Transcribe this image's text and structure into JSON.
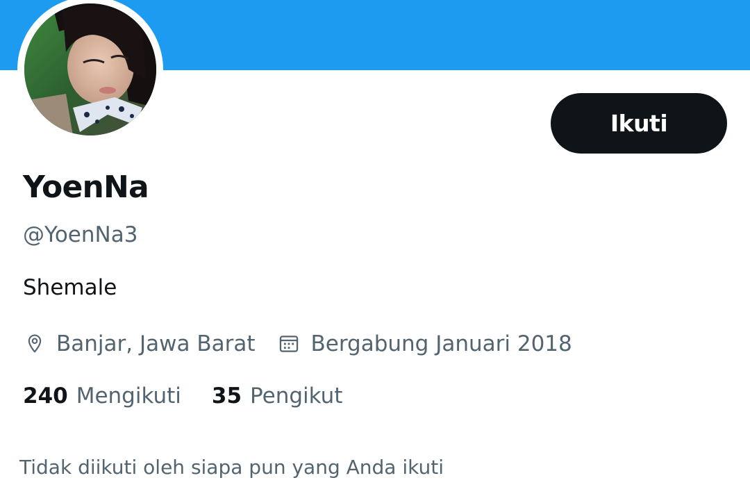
{
  "profile": {
    "display_name": "YoenNa",
    "handle": "@YoenNa3",
    "bio": "Shemale",
    "location": "Banjar, Jawa Barat",
    "joined": "Bergabung Januari 2018"
  },
  "actions": {
    "follow_label": "Ikuti"
  },
  "stats": {
    "following_count": "240",
    "following_label": "Mengikuti",
    "followers_count": "35",
    "followers_label": "Pengikut"
  },
  "footer": {
    "not_followed_text": "Tidak diikuti oleh siapa pun yang Anda ikuti"
  },
  "icons": {
    "location": "location-pin-icon",
    "joined": "calendar-icon"
  },
  "colors": {
    "banner": "#1d9bf0",
    "primary_text": "#0f1419",
    "secondary_text": "#536471",
    "button_bg": "#0f1419",
    "button_text": "#ffffff"
  }
}
